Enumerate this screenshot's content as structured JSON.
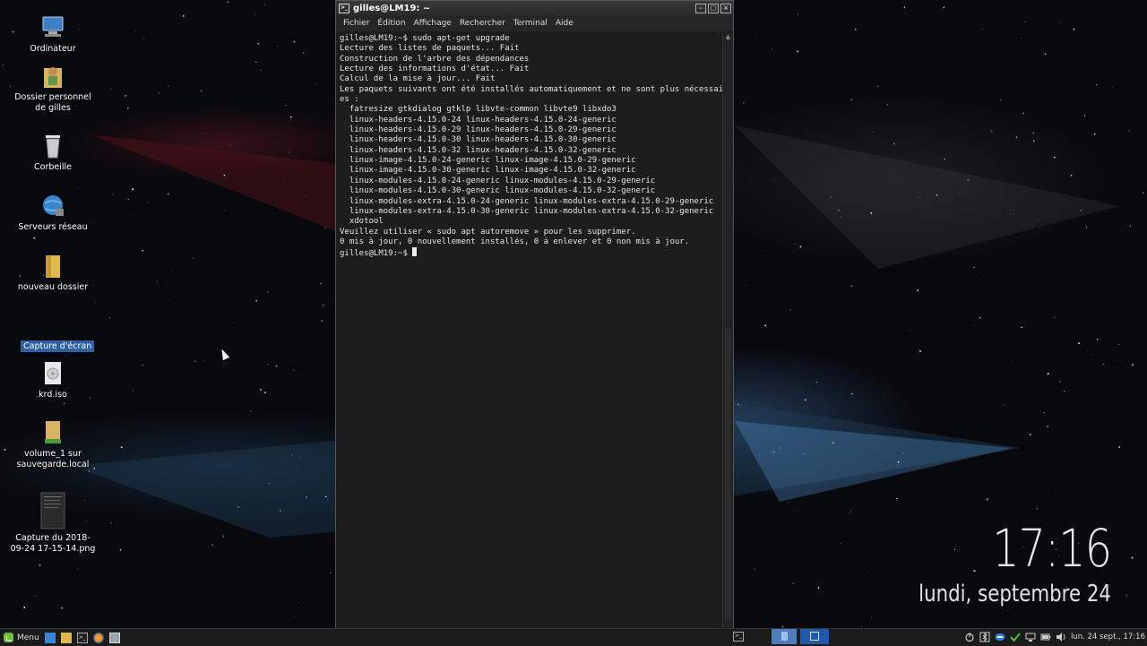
{
  "desktop": {
    "icons": [
      {
        "label": "Ordinateur"
      },
      {
        "label": "Dossier personnel de gilles"
      },
      {
        "label": "Corbeille"
      },
      {
        "label": "Serveurs réseau"
      },
      {
        "label": "nouveau dossier"
      },
      {
        "label": "Capture d'écran"
      },
      {
        "label": "krd.iso"
      },
      {
        "label": "volume_1 sur sauvegarde.local"
      },
      {
        "label": "Capture du 2018-09-24 17-15-14.png"
      }
    ],
    "clock": {
      "time": "17:16",
      "date": "lundi, septembre 24"
    }
  },
  "terminal": {
    "title": "gilles@LM19: ~",
    "menu": [
      "Fichier",
      "Édition",
      "Affichage",
      "Rechercher",
      "Terminal",
      "Aide"
    ],
    "lines": [
      "gilles@LM19:~$ sudo apt-get upgrade",
      "Lecture des listes de paquets... Fait",
      "Construction de l'arbre des dépendances",
      "Lecture des informations d'état... Fait",
      "Calcul de la mise à jour... Fait",
      "Les paquets suivants ont été installés automatiquement et ne sont plus nécessair",
      "es :",
      "  fatresize gtkdialog gtklp libvte-common libvte9 libxdo3",
      "  linux-headers-4.15.0-24 linux-headers-4.15.0-24-generic",
      "  linux-headers-4.15.0-29 linux-headers-4.15.0-29-generic",
      "  linux-headers-4.15.0-30 linux-headers-4.15.0-30-generic",
      "  linux-headers-4.15.0-32 linux-headers-4.15.0-32-generic",
      "  linux-image-4.15.0-24-generic linux-image-4.15.0-29-generic",
      "  linux-image-4.15.0-30-generic linux-image-4.15.0-32-generic",
      "  linux-modules-4.15.0-24-generic linux-modules-4.15.0-29-generic",
      "  linux-modules-4.15.0-30-generic linux-modules-4.15.0-32-generic",
      "  linux-modules-extra-4.15.0-24-generic linux-modules-extra-4.15.0-29-generic",
      "  linux-modules-extra-4.15.0-30-generic linux-modules-extra-4.15.0-32-generic",
      "  xdotool",
      "Veuillez utiliser « sudo apt autoremove » pour les supprimer.",
      "0 mis à jour, 0 nouvellement installés, 0 à enlever et 0 non mis à jour."
    ],
    "prompt": "gilles@LM19:~$ "
  },
  "taskbar": {
    "menu_label": "Menu",
    "clock": "lun. 24 sept., 17:16",
    "quick_launch_icons": [
      "show-desktop-icon",
      "files-icon",
      "terminal-icon",
      "firefox-icon",
      "screenshot-icon"
    ],
    "tray_icons": [
      "power-icon",
      "bluetooth-icon",
      "chat-icon",
      "update-ok-icon",
      "network-icon",
      "battery-icon",
      "volume-icon"
    ]
  },
  "colors": {
    "selection": "#2e5fa3",
    "workspace_active": "#1f5aa8",
    "terminal_bg": "#1d1d1d"
  }
}
